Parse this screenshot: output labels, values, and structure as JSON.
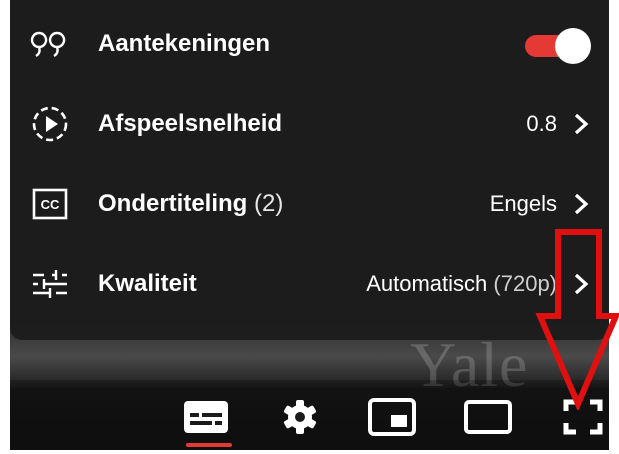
{
  "menu": {
    "items": [
      {
        "icon": "annotations-icon",
        "label": "Aantekeningen",
        "control": "toggle",
        "toggle_on": true
      },
      {
        "icon": "playback-speed-icon",
        "label": "Afspeelsnelheid",
        "value": "0.8"
      },
      {
        "icon": "subtitles-cc-icon",
        "label": "Ondertiteling",
        "label_suffix": "(2)",
        "value": "Engels"
      },
      {
        "icon": "quality-sliders-icon",
        "label": "Kwaliteit",
        "value": "Automatisch",
        "value_suffix": "(720p)"
      }
    ]
  },
  "video": {
    "watermark": "Yale"
  },
  "controls": {
    "buttons": [
      {
        "icon": "subtitles-icon",
        "active": true
      },
      {
        "icon": "settings-gear-icon"
      },
      {
        "icon": "miniplayer-icon"
      },
      {
        "icon": "theater-mode-icon"
      },
      {
        "icon": "fullscreen-icon"
      }
    ]
  },
  "annotation": {
    "type": "arrow",
    "points_to": "fullscreen-icon"
  },
  "colors": {
    "menu_bg": "#1c1c1c",
    "accent_red": "#e53935",
    "text": "#ffffff",
    "annotation_red": "#e01010"
  }
}
